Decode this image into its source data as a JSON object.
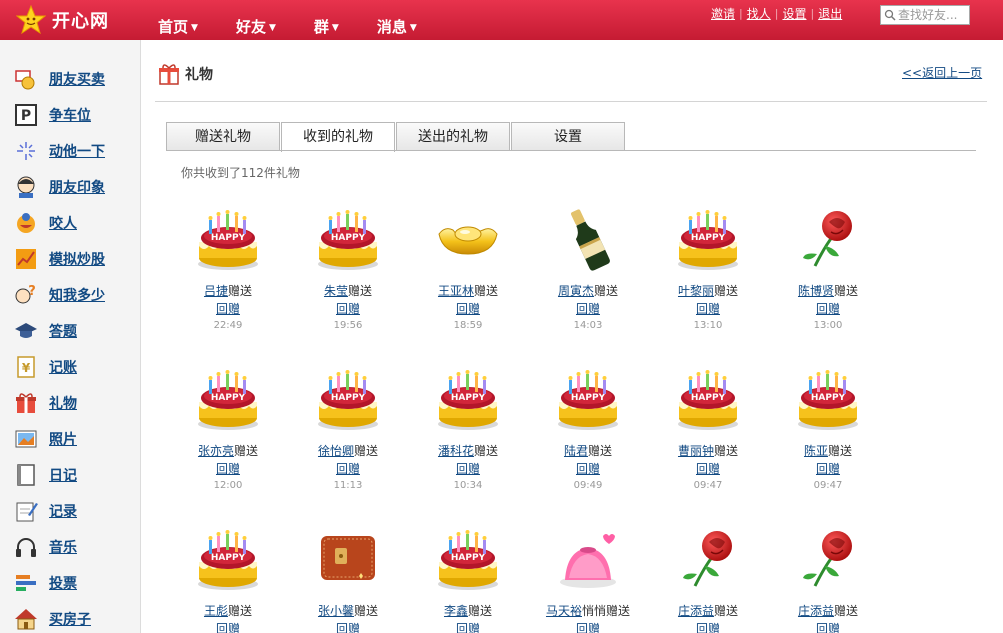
{
  "app": {
    "name": "开心网"
  },
  "nav": [
    {
      "label": "首页"
    },
    {
      "label": "好友"
    },
    {
      "label": "群"
    },
    {
      "label": "消息"
    }
  ],
  "top_links": [
    {
      "label": "邀请"
    },
    {
      "label": "找人"
    },
    {
      "label": "设置"
    },
    {
      "label": "退出"
    }
  ],
  "search": {
    "placeholder": "查找好友..."
  },
  "sidebar": {
    "items": [
      {
        "label": "朋友买卖",
        "icon": "trade-icon"
      },
      {
        "label": "争车位",
        "icon": "parking-icon"
      },
      {
        "label": "动他一下",
        "icon": "sparkle-icon"
      },
      {
        "label": "朋友印象",
        "icon": "face-icon"
      },
      {
        "label": "咬人",
        "icon": "bite-icon"
      },
      {
        "label": "模拟炒股",
        "icon": "stock-chart-icon"
      },
      {
        "label": "知我多少",
        "icon": "quiz-icon"
      },
      {
        "label": "答题",
        "icon": "graduation-cap-icon"
      },
      {
        "label": "记账",
        "icon": "ledger-icon"
      },
      {
        "label": "礼物",
        "icon": "gift-icon"
      },
      {
        "label": "照片",
        "icon": "photo-icon"
      },
      {
        "label": "日记",
        "icon": "diary-icon"
      },
      {
        "label": "记录",
        "icon": "notepad-icon"
      },
      {
        "label": "音乐",
        "icon": "headphones-icon"
      },
      {
        "label": "投票",
        "icon": "vote-bars-icon"
      },
      {
        "label": "买房子",
        "icon": "house-icon"
      }
    ]
  },
  "page": {
    "title": "礼物",
    "back_link": "<<返回上一页",
    "tabs": [
      {
        "label": "赠送礼物"
      },
      {
        "label": "收到的礼物"
      },
      {
        "label": "送出的礼物"
      },
      {
        "label": "设置"
      }
    ],
    "summary": "你共收到了112件礼物",
    "gifts": [
      {
        "sender": "吕捷",
        "action": "赠送",
        "reply": "回赠",
        "time": "22:49",
        "gift": "cake"
      },
      {
        "sender": "朱莹",
        "action": "赠送",
        "reply": "回赠",
        "time": "19:56",
        "gift": "cake"
      },
      {
        "sender": "王亚林",
        "action": "赠送",
        "reply": "回赠",
        "time": "18:59",
        "gift": "gold-ingot"
      },
      {
        "sender": "周寅杰",
        "action": "赠送",
        "reply": "回赠",
        "time": "14:03",
        "gift": "champagne"
      },
      {
        "sender": "叶黎丽",
        "action": "赠送",
        "reply": "回赠",
        "time": "13:10",
        "gift": "cake"
      },
      {
        "sender": "陈博贤",
        "action": "赠送",
        "reply": "回赠",
        "time": "13:00",
        "gift": "rose"
      },
      {
        "sender": "张亦亮",
        "action": "赠送",
        "reply": "回赠",
        "time": "12:00",
        "gift": "cake"
      },
      {
        "sender": "徐怡卿",
        "action": "赠送",
        "reply": "回赠",
        "time": "11:13",
        "gift": "cake"
      },
      {
        "sender": "潘科花",
        "action": "赠送",
        "reply": "回赠",
        "time": "10:34",
        "gift": "cake"
      },
      {
        "sender": "陆君",
        "action": "赠送",
        "reply": "回赠",
        "time": "09:49",
        "gift": "cake"
      },
      {
        "sender": "曹丽钟",
        "action": "赠送",
        "reply": "回赠",
        "time": "09:47",
        "gift": "cake"
      },
      {
        "sender": "陈亚",
        "action": "赠送",
        "reply": "回赠",
        "time": "09:47",
        "gift": "cake"
      },
      {
        "sender": "王彪",
        "action": "赠送",
        "reply": "回赠",
        "time": "",
        "gift": "cake"
      },
      {
        "sender": "张小馨",
        "action": "赠送",
        "reply": "回赠",
        "time": "",
        "gift": "wallet"
      },
      {
        "sender": "李鑫",
        "action": "赠送",
        "reply": "回赠",
        "time": "",
        "gift": "cake"
      },
      {
        "sender": "马天裕",
        "action": "悄悄赠送",
        "reply": "回赠",
        "time": "",
        "gift": "jelly"
      },
      {
        "sender": "庄添益",
        "action": "赠送",
        "reply": "回赠",
        "time": "",
        "gift": "rose"
      },
      {
        "sender": "庄添益",
        "action": "赠送",
        "reply": "回赠",
        "time": "",
        "gift": "rose"
      }
    ]
  },
  "colors": {
    "header_red": "#d6243d",
    "link_blue": "#124a83",
    "sidebar_bg": "#f4f4f4"
  }
}
